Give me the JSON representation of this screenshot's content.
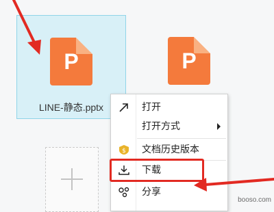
{
  "files": [
    {
      "name": "LINE-静态.pptx",
      "icon_letter": "P",
      "selected": true
    },
    {
      "name": "",
      "icon_letter": "P",
      "selected": false
    }
  ],
  "context_menu": {
    "items": [
      {
        "label": "打开",
        "icon": "open-arrow-icon"
      },
      {
        "label": "打开方式",
        "icon": "none",
        "has_submenu": true
      },
      {
        "label": "文档历史版本",
        "icon": "history-version-icon"
      },
      {
        "label": "下载",
        "icon": "download-icon",
        "highlighted": true
      },
      {
        "label": "分享",
        "icon": "share-icon"
      }
    ]
  },
  "add_button_icon": "plus-icon",
  "annotations": {
    "arrow_color": "#e22a22",
    "highlight_color": "#e22a22"
  },
  "colors": {
    "ppt_orange": "#f47a3c",
    "selection_bg": "#d8f0f7"
  },
  "watermark": "booso.com"
}
